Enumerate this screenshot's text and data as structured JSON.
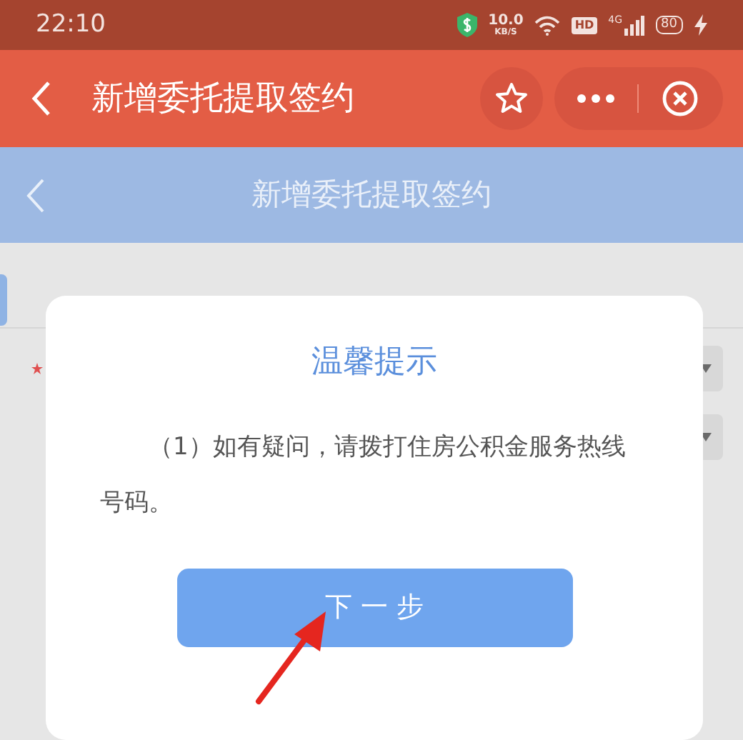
{
  "status_bar": {
    "time": "22:10",
    "speed": "10.0",
    "speed_unit": "KB/S",
    "hd_badge": "HD",
    "network": "4G",
    "battery": "80",
    "charging": true
  },
  "mini_program_bar": {
    "title": "新增委托提取签约"
  },
  "page_header": {
    "title": "新增委托提取签约"
  },
  "form": {
    "rows": [
      {
        "required": true,
        "kind": "select"
      },
      {
        "required": false,
        "kind": "select"
      }
    ]
  },
  "dialog": {
    "title": "温馨提示",
    "message": "（1）如有疑问，请拨打住房公积金服务热线号码。",
    "button": "下 一 步"
  }
}
